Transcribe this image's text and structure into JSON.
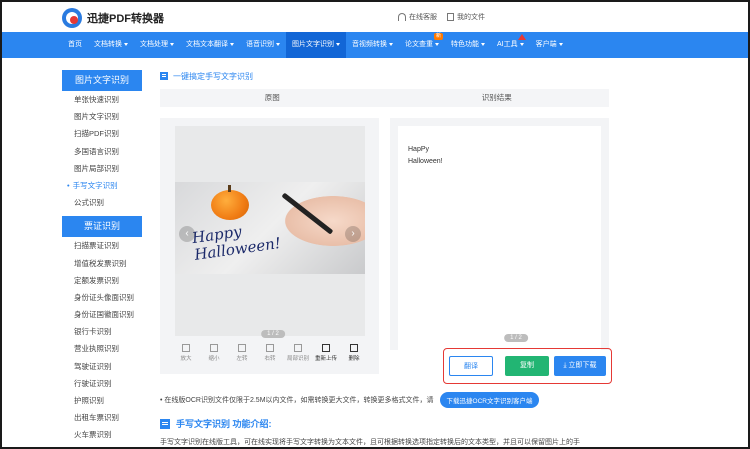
{
  "header": {
    "logo_text": "迅捷PDF转换器",
    "links": [
      {
        "label": "在线客服",
        "icon": "headset-icon"
      },
      {
        "label": "我的文件",
        "icon": "document-icon"
      }
    ]
  },
  "nav": {
    "items": [
      {
        "label": "首页",
        "caret": false
      },
      {
        "label": "文档转换",
        "caret": true
      },
      {
        "label": "文档处理",
        "caret": true
      },
      {
        "label": "文档文本翻译",
        "caret": true
      },
      {
        "label": "语音识别",
        "caret": true
      },
      {
        "label": "图片文字识别",
        "caret": true,
        "active": true
      },
      {
        "label": "音视频转换",
        "caret": true
      },
      {
        "label": "论文查重",
        "caret": true,
        "badge": "新"
      },
      {
        "label": "特色功能",
        "caret": true
      },
      {
        "label": "AI工具",
        "caret": true,
        "hot": true
      },
      {
        "label": "客户端",
        "caret": true
      }
    ]
  },
  "sidebar": {
    "group1_title": "图片文字识别",
    "group1_items": [
      "单张快速识别",
      "图片文字识别",
      "扫描PDF识别",
      "多国语言识别",
      "图片局部识别",
      "手写文字识别",
      "公式识别"
    ],
    "group1_active_index": 5,
    "group2_title": "票证识别",
    "group2_items": [
      "扫描票证识别",
      "增值税发票识别",
      "定额发票识别",
      "身份证头像面识别",
      "身份证国徽面识别",
      "银行卡识别",
      "营业执照识别",
      "驾驶证识别",
      "行驶证识别",
      "护照识别",
      "出租车票识别",
      "火车票识别"
    ]
  },
  "main": {
    "section_title": "一键搞定手写文字识别",
    "tab_original": "原图",
    "tab_result": "识别结果",
    "handwriting": "Happy Halloween!",
    "page_indicator_left": "1 / 2",
    "page_indicator_right": "1 / 2",
    "result_lines": [
      "HapPy",
      "Halloween!"
    ],
    "tools": [
      {
        "label": "放大",
        "icon": "zoom-in-icon"
      },
      {
        "label": "缩小",
        "icon": "zoom-out-icon"
      },
      {
        "label": "左转",
        "icon": "rotate-left-icon"
      },
      {
        "label": "右转",
        "icon": "rotate-right-icon"
      },
      {
        "label": "局部识别",
        "icon": "crop-icon"
      },
      {
        "label": "重新上传",
        "icon": "reload-icon"
      },
      {
        "label": "删除",
        "icon": "trash-icon"
      }
    ],
    "btn_retranslate": "翻译",
    "btn_copy": "复制",
    "btn_download": "立即下载",
    "notice_text": "在线版OCR识别文件仅限于2.5M以内文件，如需转换更大文件，转换更多格式文件，请",
    "notice_button": "下载迅捷OCR文字识别客户端",
    "intro_title": "手写文字识别 功能介绍:",
    "intro_text": "手写文字识别在线版工具，可在线实现将手写文字转换为文本文件，且可根据转换选项指定转换后的文本类型，并且可以保留图片上的手"
  },
  "colors": {
    "accent": "#2b86f0",
    "nav_active": "#1266d6",
    "highlight_border": "#e53935",
    "copy_green": "#22b573"
  }
}
